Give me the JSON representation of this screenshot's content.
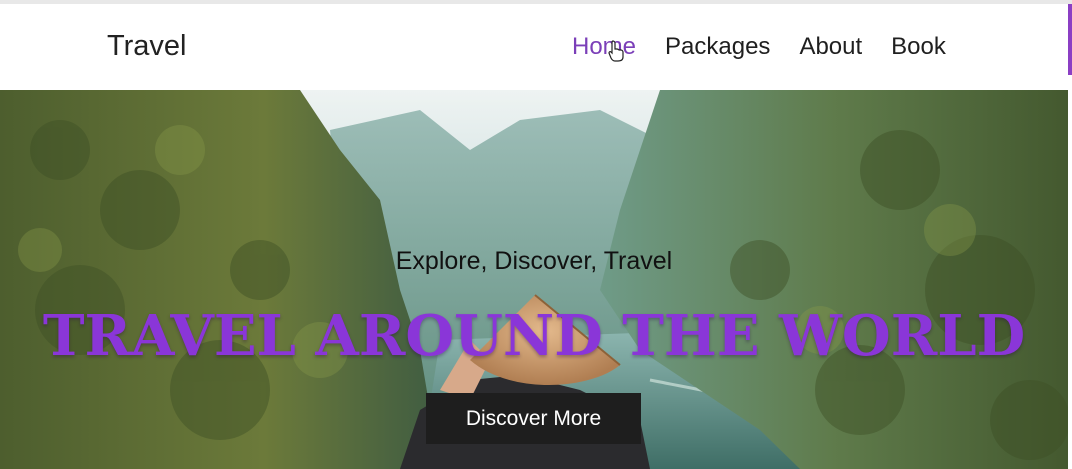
{
  "nav": {
    "brand": "Travel",
    "links": [
      {
        "label": "Home",
        "active": true
      },
      {
        "label": "Packages",
        "active": false
      },
      {
        "label": "About",
        "active": false
      },
      {
        "label": "Book",
        "active": false
      }
    ]
  },
  "hero": {
    "tagline": "Explore, Discover, Travel",
    "title": "TRAVEL AROUND THE WORLD",
    "button_label": "Discover More"
  },
  "colors": {
    "accent": "#8a36d8",
    "active_link": "#7b3fb8",
    "button_bg": "#1e1e1e"
  }
}
